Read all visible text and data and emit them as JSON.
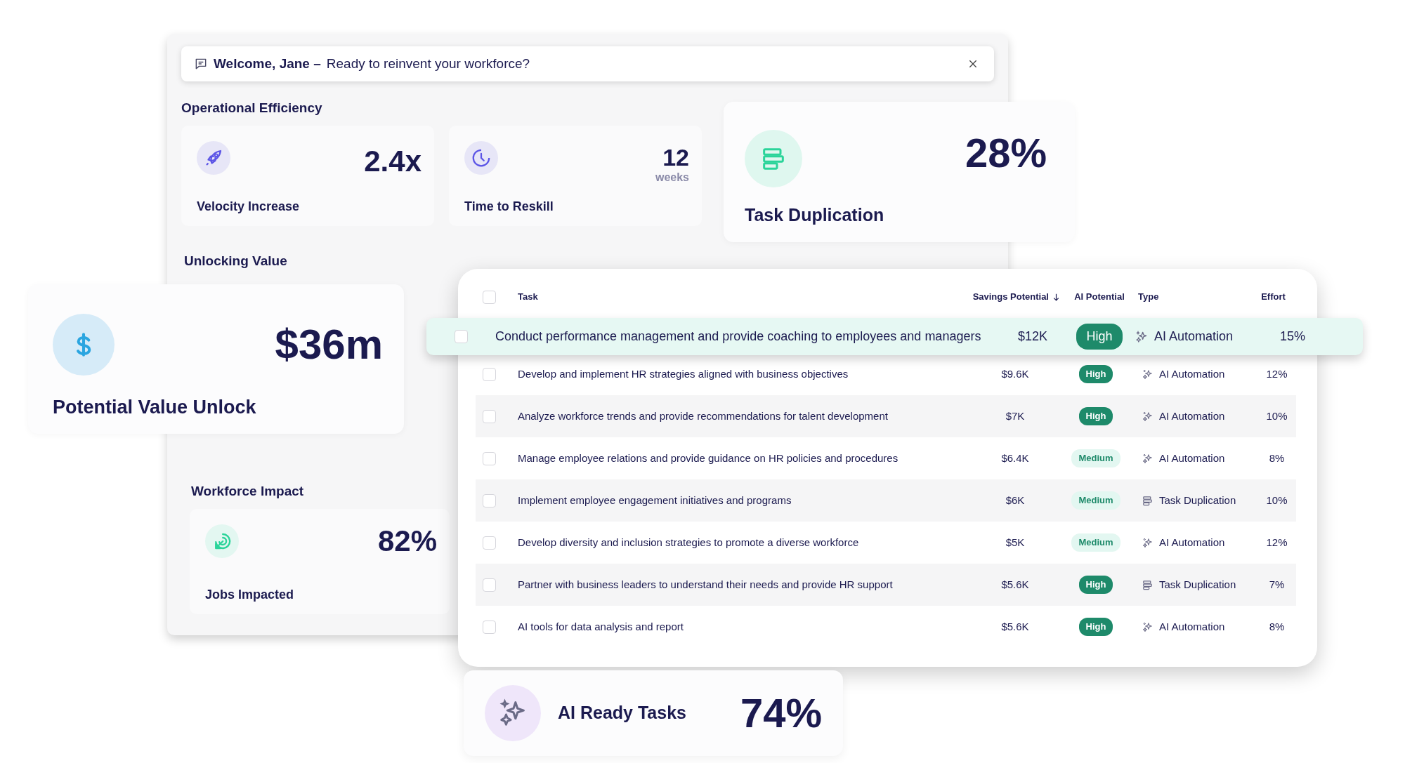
{
  "banner": {
    "greeting": "Welcome, Jane –",
    "message": "Ready to reinvent your workforce?"
  },
  "operational_efficiency": {
    "heading": "Operational Efficiency",
    "metrics": [
      {
        "kind": "rocket",
        "value": "2.4x",
        "label": "Velocity Increase"
      },
      {
        "kind": "clock",
        "value": "12",
        "unit": "weeks",
        "label": "Time to Reskill"
      }
    ]
  },
  "task_duplication": {
    "value": "28%",
    "label": "Task Duplication"
  },
  "unlocking_value": {
    "heading": "Unlocking Value"
  },
  "potential_value": {
    "value": "$36m",
    "label": "Potential Value Unlock"
  },
  "workforce_impact": {
    "heading": "Workforce Impact",
    "value": "82%",
    "label": "Jobs Impacted"
  },
  "task_table": {
    "select_all": {
      "checked": false
    },
    "columns": [
      {
        "label": "Task",
        "sorted": false
      },
      {
        "label": "Savings Potential",
        "sorted": true
      },
      {
        "label": "AI Potential",
        "sorted": false
      },
      {
        "label": "Type",
        "sorted": false
      },
      {
        "label": "Effort",
        "sorted": false
      }
    ],
    "rows": [
      {
        "task": "Conduct performance management and provide coaching to employees and managers",
        "savings": "$12K",
        "ai_potential": {
          "label": "High",
          "kind": "high"
        },
        "type": {
          "label": "AI Automation",
          "kind": "automation"
        },
        "effort": "15%",
        "checked": false,
        "highlighted": true
      },
      {
        "task": "Develop and implement HR strategies aligned with business objectives",
        "savings": "$9.6K",
        "ai_potential": {
          "label": "High",
          "kind": "high"
        },
        "type": {
          "label": "AI Automation",
          "kind": "automation"
        },
        "effort": "12%",
        "checked": false,
        "highlighted": false
      },
      {
        "task": "Analyze workforce trends and provide recommendations for talent development",
        "savings": "$7K",
        "ai_potential": {
          "label": "High",
          "kind": "high"
        },
        "type": {
          "label": "AI Automation",
          "kind": "automation"
        },
        "effort": "10%",
        "checked": false,
        "highlighted": false
      },
      {
        "task": "Manage employee relations and provide guidance on HR policies and procedures",
        "savings": "$6.4K",
        "ai_potential": {
          "label": "Medium",
          "kind": "medium"
        },
        "type": {
          "label": "AI Automation",
          "kind": "automation"
        },
        "effort": "8%",
        "checked": false,
        "highlighted": false
      },
      {
        "task": "Implement employee engagement initiatives and programs",
        "savings": "$6K",
        "ai_potential": {
          "label": "Medium",
          "kind": "medium"
        },
        "type": {
          "label": "Task Duplication",
          "kind": "duplication"
        },
        "effort": "10%",
        "checked": false,
        "highlighted": false
      },
      {
        "task": "Develop diversity and inclusion strategies to promote a diverse workforce",
        "savings": "$5K",
        "ai_potential": {
          "label": "Medium",
          "kind": "medium"
        },
        "type": {
          "label": "AI Automation",
          "kind": "automation"
        },
        "effort": "12%",
        "checked": false,
        "highlighted": false
      },
      {
        "task": "Partner with business leaders to understand their needs and provide HR support",
        "savings": "$5.6K",
        "ai_potential": {
          "label": "High",
          "kind": "high"
        },
        "type": {
          "label": "Task Duplication",
          "kind": "duplication"
        },
        "effort": "7%",
        "checked": false,
        "highlighted": false
      },
      {
        "task": "AI tools for data analysis and report",
        "savings": "$5.6K",
        "ai_potential": {
          "label": "High",
          "kind": "high"
        },
        "type": {
          "label": "AI Automation",
          "kind": "automation"
        },
        "effort": "8%",
        "checked": false,
        "highlighted": false
      }
    ]
  },
  "ai_ready": {
    "value": "74%",
    "label": "AI Ready Tasks"
  }
}
